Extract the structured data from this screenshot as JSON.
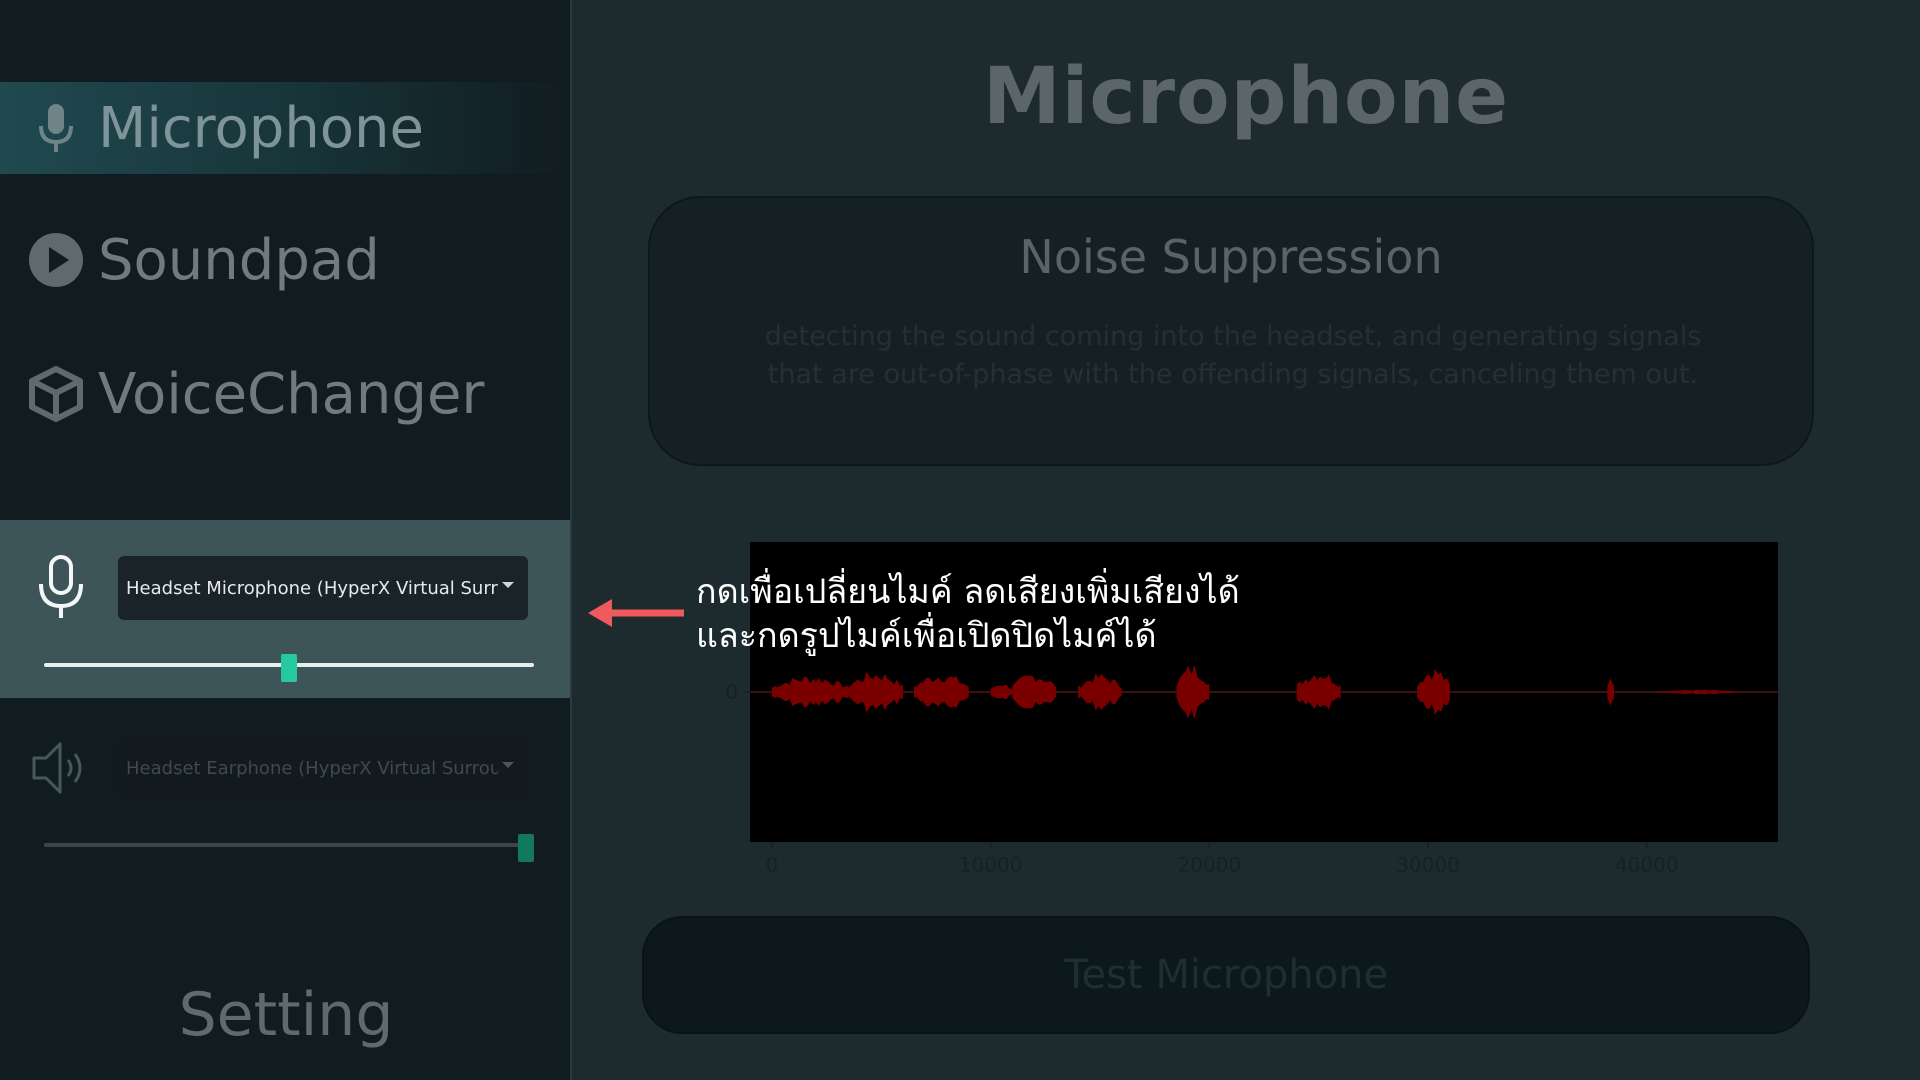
{
  "sidebar": {
    "items": [
      {
        "label": "Microphone",
        "icon": "microphone-icon",
        "active": true
      },
      {
        "label": "Soundpad",
        "icon": "play-circle-icon",
        "active": false
      },
      {
        "label": "VoiceChanger",
        "icon": "cube-icon",
        "active": false
      }
    ],
    "mic_device": {
      "selected": "Headset Microphone (HyperX Virtual Surrou",
      "volume": 0.5
    },
    "speaker_device": {
      "selected": "Headset Earphone (HyperX Virtual Surround",
      "volume": 1.0
    },
    "setting_label": "Setting"
  },
  "main": {
    "title": "Microphone",
    "noise_suppression": {
      "title": "Noise Suppression",
      "description_line1": "detecting the sound coming into the headset, and generating signals",
      "description_line2": "that are  out-of-phase with the  offending signals, canceling them out."
    },
    "test_button_label": "Test Microphone"
  },
  "tutorial": {
    "line1": "กดเพื่อเปลี่ยนไมค์ ลดเสียงเพิ่มเสียงได้",
    "line2": "และกดรูปไมค์เพื่อเปิดปิดไมค์ได้"
  },
  "chart_data": {
    "type": "line",
    "xlim": [
      -1000,
      46000
    ],
    "x_ticks": [
      "0",
      "10000",
      "20000",
      "30000",
      "40000"
    ],
    "y_ticks": [
      "0"
    ],
    "series": [
      {
        "color": "#7a0000"
      }
    ],
    "bursts": [
      {
        "start": 0,
        "end": 3500,
        "amp": 0.6
      },
      {
        "start": 3500,
        "end": 6000,
        "amp": 0.75
      },
      {
        "start": 6500,
        "end": 9000,
        "amp": 0.7
      },
      {
        "start": 10000,
        "end": 11000,
        "amp": 0.35
      },
      {
        "start": 11000,
        "end": 13000,
        "amp": 0.7
      },
      {
        "start": 14000,
        "end": 16000,
        "amp": 0.65
      },
      {
        "start": 18500,
        "end": 20000,
        "amp": 1.0
      },
      {
        "start": 24000,
        "end": 26000,
        "amp": 0.8
      },
      {
        "start": 29500,
        "end": 31000,
        "amp": 0.9
      },
      {
        "start": 38200,
        "end": 38500,
        "amp": 0.7
      },
      {
        "start": 40500,
        "end": 44000,
        "amp": 0.08
      }
    ]
  },
  "colors": {
    "background": "#1e2b2e",
    "sidebar": "#111c20",
    "active_panel": "#3d5459",
    "accent": "#25c9a0",
    "waveform": "#7a0000",
    "arrow": "#f05a5e"
  }
}
